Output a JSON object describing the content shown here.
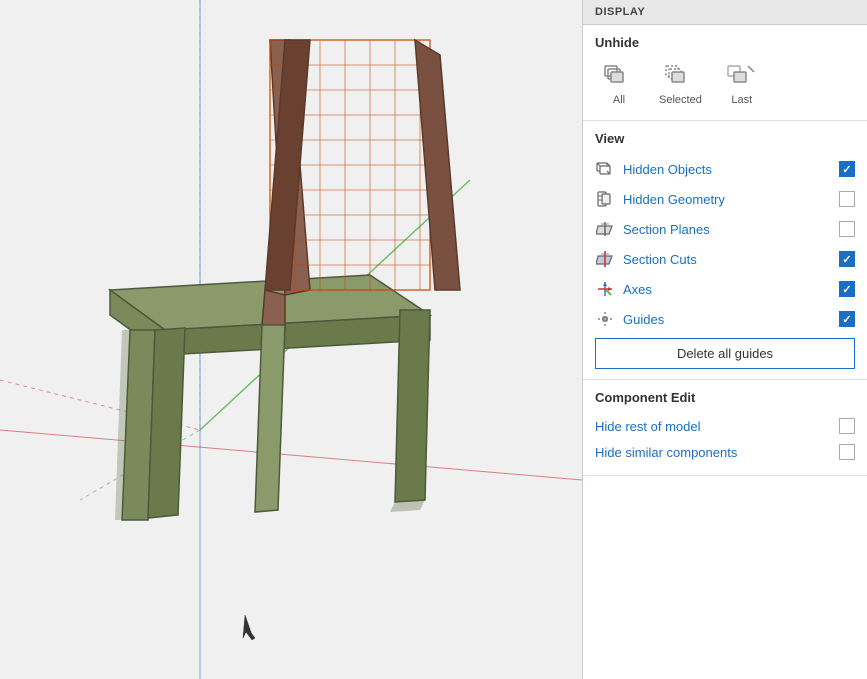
{
  "panel": {
    "header": "DISPLAY",
    "unhide": {
      "title": "Unhide",
      "buttons": [
        {
          "id": "all",
          "label": "All"
        },
        {
          "id": "selected",
          "label": "Selected"
        },
        {
          "id": "last",
          "label": "Last"
        }
      ]
    },
    "view": {
      "title": "View",
      "items": [
        {
          "id": "hidden-objects",
          "label": "Hidden Objects",
          "checked": true
        },
        {
          "id": "hidden-geometry",
          "label": "Hidden Geometry",
          "checked": false
        },
        {
          "id": "section-planes",
          "label": "Section Planes",
          "checked": false
        },
        {
          "id": "section-cuts",
          "label": "Section Cuts",
          "checked": true
        },
        {
          "id": "axes",
          "label": "Axes",
          "checked": true
        },
        {
          "id": "guides",
          "label": "Guides",
          "checked": true
        }
      ],
      "delete_guides_label": "Delete all guides"
    },
    "component_edit": {
      "title": "Component Edit",
      "items": [
        {
          "id": "hide-rest",
          "label": "Hide rest of model",
          "checked": false
        },
        {
          "id": "hide-similar",
          "label": "Hide similar components",
          "checked": false
        }
      ]
    }
  }
}
